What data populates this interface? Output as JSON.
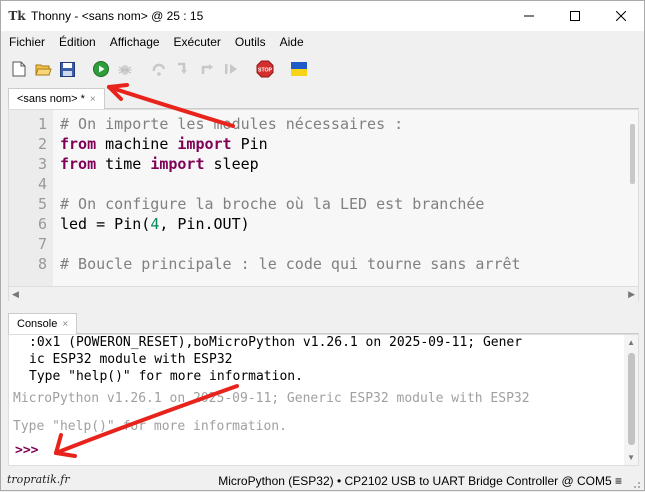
{
  "window": {
    "title": "Thonny  -  <sans nom>  @  25 : 15",
    "app_icon_glyph": "Tk"
  },
  "menu": [
    "Fichier",
    "Édition",
    "Affichage",
    "Exécuter",
    "Outils",
    "Aide"
  ],
  "toolbar": {
    "icons": [
      "new-file-icon",
      "open-folder-icon",
      "save-icon",
      "run-icon",
      "debug-icon",
      "step-over-icon",
      "step-into-icon",
      "step-out-icon",
      "resume-icon",
      "stop-icon",
      "ukraine-flag-icon"
    ],
    "stop_label": "STOP"
  },
  "editor": {
    "tab_label": "<sans nom> *",
    "tab_close": "×",
    "line_numbers": [
      "1",
      "2",
      "3",
      "4",
      "5",
      "6",
      "7",
      "8"
    ],
    "lines": [
      [
        {
          "t": "# On importe les modules nécessaires :",
          "c": "cm"
        }
      ],
      [
        {
          "t": "from",
          "c": "kw"
        },
        {
          "t": " machine ",
          "c": ""
        },
        {
          "t": "import",
          "c": "kw"
        },
        {
          "t": " Pin",
          "c": ""
        }
      ],
      [
        {
          "t": "from",
          "c": "kw"
        },
        {
          "t": " time ",
          "c": ""
        },
        {
          "t": "import",
          "c": "kw"
        },
        {
          "t": " sleep",
          "c": ""
        }
      ],
      [
        {
          "t": "",
          "c": ""
        }
      ],
      [
        {
          "t": "# On configure la broche où la LED est branchée",
          "c": "cm"
        }
      ],
      [
        {
          "t": "led = Pin(",
          "c": ""
        },
        {
          "t": "4",
          "c": "num"
        },
        {
          "t": ", Pin.OUT)",
          "c": ""
        }
      ],
      [
        {
          "t": "",
          "c": ""
        }
      ],
      [
        {
          "t": "# Boucle principale : le code qui tourne sans arrêt",
          "c": "cm"
        }
      ]
    ]
  },
  "console": {
    "tab_label": "Console",
    "tab_close": "×",
    "lines": [
      {
        "text": ":0x1 (POWERON_RESET),boMicroPython v1.26.1 on 2025-09-11; Gener",
        "style": "normal",
        "indent": true
      },
      {
        "text": "ic ESP32 module with ESP32",
        "style": "normal",
        "indent": true
      },
      {
        "text": "Type \"help()\" for more information.",
        "style": "normal",
        "indent": true
      },
      {
        "text": "MicroPython v1.26.1 on 2025-09-11; Generic ESP32 module with ESP32",
        "style": "gray",
        "indent": false
      },
      {
        "text": "",
        "style": "gray",
        "indent": false
      },
      {
        "text": "Type \"help()\" for more information.",
        "style": "gray",
        "indent": false
      }
    ],
    "prompt": ">>>"
  },
  "statusbar": {
    "watermark": "tropratik.fr",
    "text": "MicroPython (ESP32)  •  CP2102 USB to UART Bridge Controller @ COM5  ≡"
  },
  "colors": {
    "keyword": "#7f0055",
    "comment": "#808080",
    "number": "#098658",
    "annotation_arrow": "#e8231c"
  }
}
